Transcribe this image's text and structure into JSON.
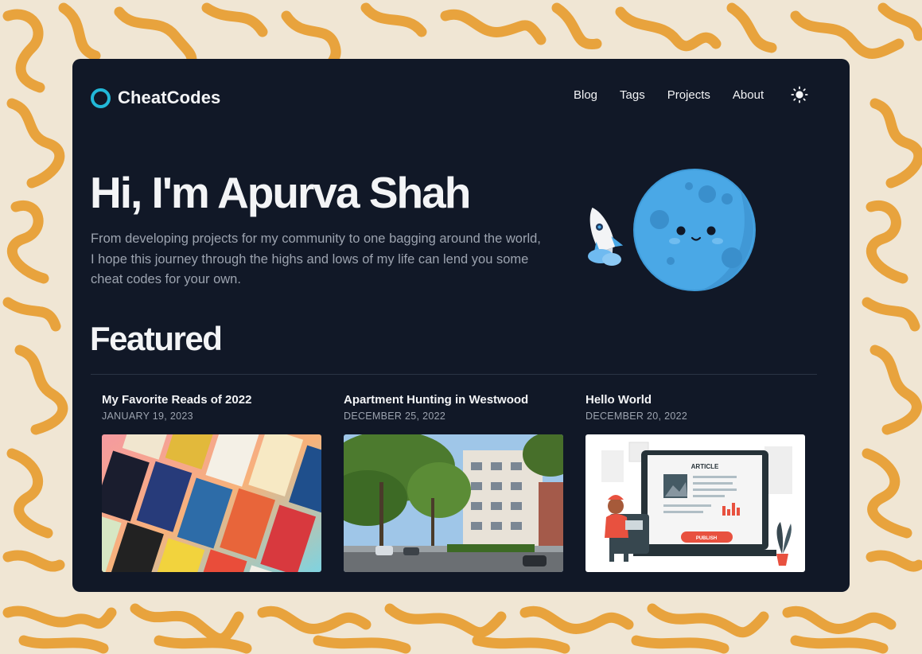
{
  "site": {
    "name": "CheatCodes"
  },
  "nav": {
    "items": [
      "Blog",
      "Tags",
      "Projects",
      "About"
    ],
    "theme_toggle_icon": "sun-icon"
  },
  "hero": {
    "title": "Hi, I'm Apurva Shah",
    "description": "From developing projects for my community to one bagging around the world, I hope this journey through the highs and lows of my life can lend you some cheat codes for your own.",
    "illustration": "rocket-and-moon-illustration"
  },
  "featured": {
    "heading": "Featured",
    "posts": [
      {
        "title": "My Favorite Reads of 2022",
        "date": "JANUARY 19, 2023",
        "image": "books-collage-image"
      },
      {
        "title": "Apartment Hunting in Westwood",
        "date": "DECEMBER 25, 2022",
        "image": "apartment-street-photo"
      },
      {
        "title": "Hello World",
        "date": "DECEMBER 20, 2022",
        "image": "publish-article-illustration"
      }
    ]
  },
  "colors": {
    "background_pattern": "#e8a33d",
    "background_base": "#f0e6d4",
    "window": "#111827",
    "accent": "#22b8d8",
    "text_primary": "#f3f4f6",
    "text_secondary": "#9ca3af",
    "moon": "#4aa8e6"
  }
}
